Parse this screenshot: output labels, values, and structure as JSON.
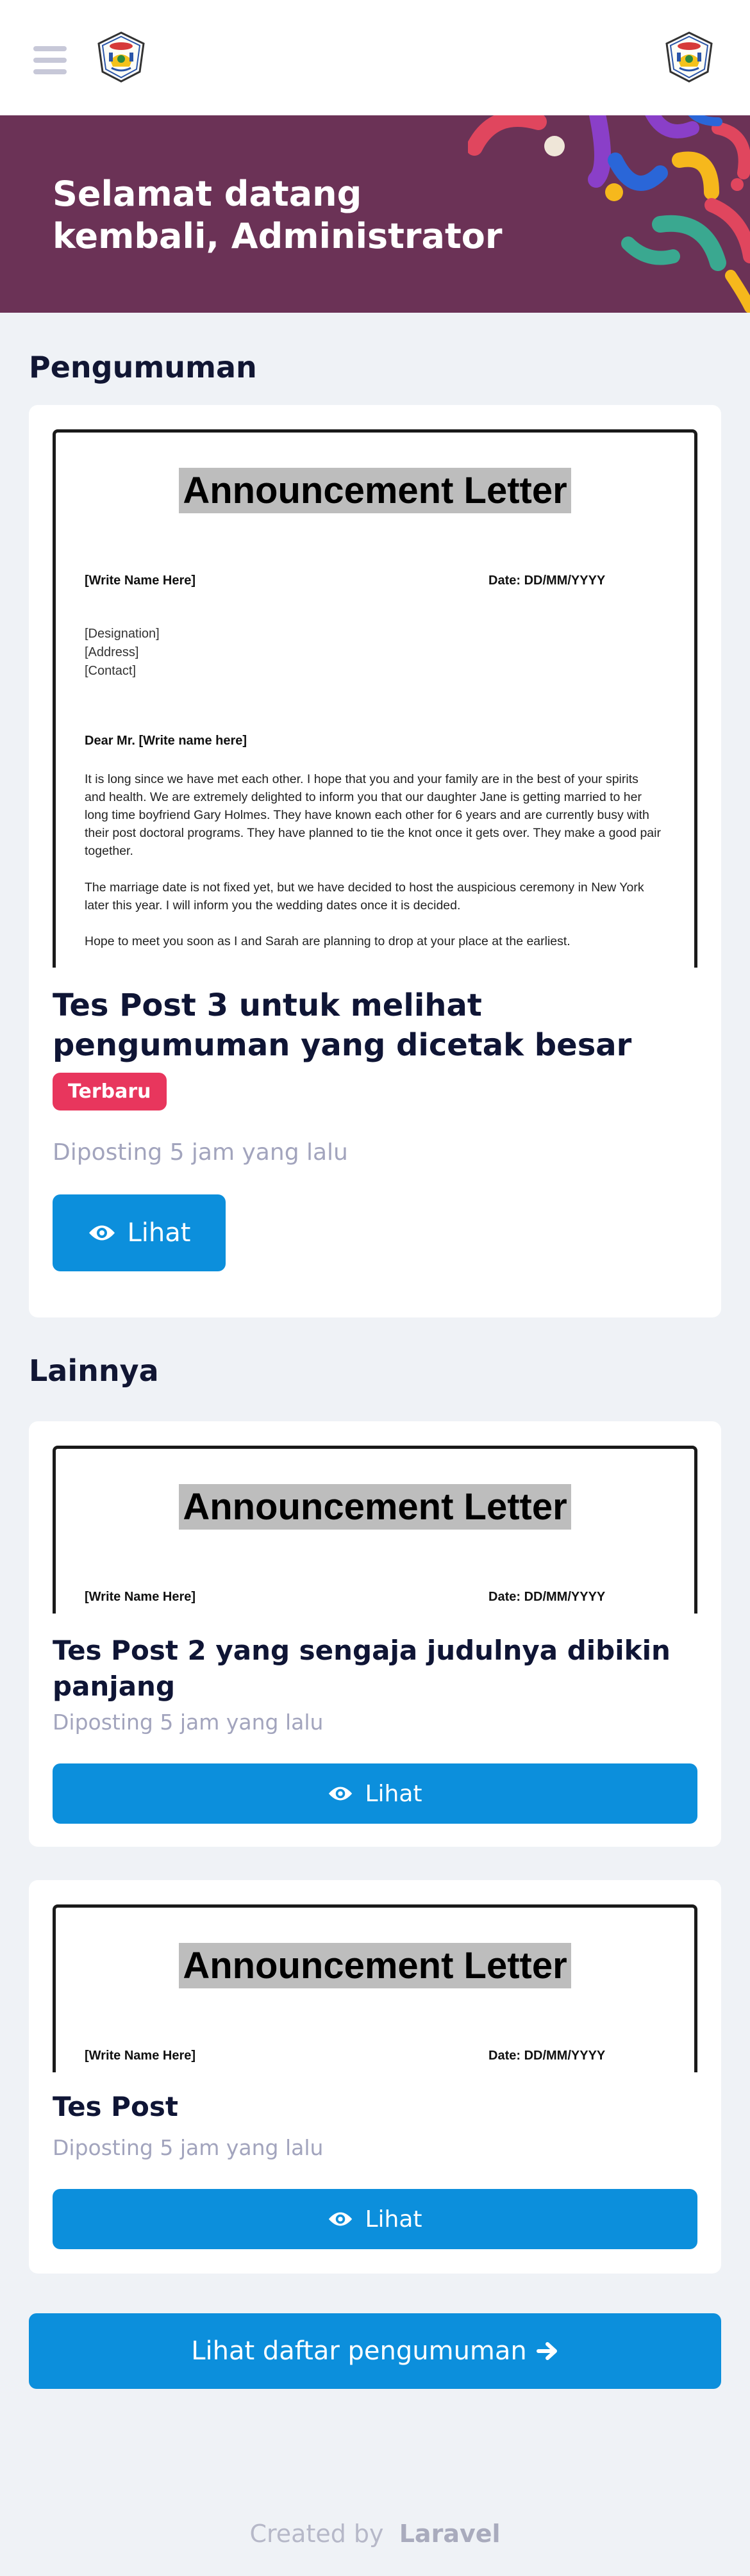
{
  "header": {
    "menu_icon": "hamburger-icon",
    "logo_icon": "school-emblem-icon"
  },
  "banner": {
    "welcome_text": "Selamat datang kembali, Administrator"
  },
  "announcements": {
    "heading": "Pengumuman",
    "featured": {
      "image": {
        "title": "Announcement Letter",
        "name_line": "[Write Name Here]",
        "date_line": "Date: DD/MM/YYYY",
        "designation": "[Designation]",
        "address": "[Address]",
        "contact": "[Contact]",
        "salutation": "Dear Mr. [Write name here]",
        "paragraph1": "It is long since we have met each other. I hope that you and your family are in the best of your spirits and health. We are extremely delighted to inform you that our daughter Jane is getting married to her long time boyfriend Gary Holmes. They have known each other for 6 years and are currently busy with their post doctoral programs. They have planned to tie the knot once it gets over. They make a good pair together.",
        "paragraph2": "The marriage date is not fixed yet, but we have decided to host the auspicious ceremony in New York later this year. I will inform you the wedding dates once it is decided.",
        "paragraph3": "Hope to meet you soon as I and Sarah are planning to drop at your place at the earliest."
      },
      "title": "Tes Post 3 untuk melihat pengumuman yang dicetak besar",
      "badge": "Terbaru",
      "posted": "Diposting 5 jam yang lalu",
      "button": "Lihat"
    },
    "others_heading": "Lainnya",
    "others": [
      {
        "image_title": "Announcement Letter",
        "name_line": "[Write Name Here]",
        "date_line": "Date: DD/MM/YYYY",
        "title": "Tes Post 2 yang sengaja judulnya dibikin panjang",
        "posted": "Diposting 5 jam yang lalu",
        "button": "Lihat"
      },
      {
        "image_title": "Announcement Letter",
        "name_line": "[Write Name Here]",
        "date_line": "Date: DD/MM/YYYY",
        "title": "Tes Post",
        "posted": "Diposting 5 jam yang lalu",
        "button": "Lihat"
      }
    ],
    "list_button": "Lihat daftar pengumuman"
  },
  "footer": {
    "created_by": "Created by",
    "brand": "Laravel"
  },
  "colors": {
    "banner": "#6b3256",
    "primary": "#0c8fdc",
    "badge": "#e8365d",
    "background": "#eff2f6"
  }
}
